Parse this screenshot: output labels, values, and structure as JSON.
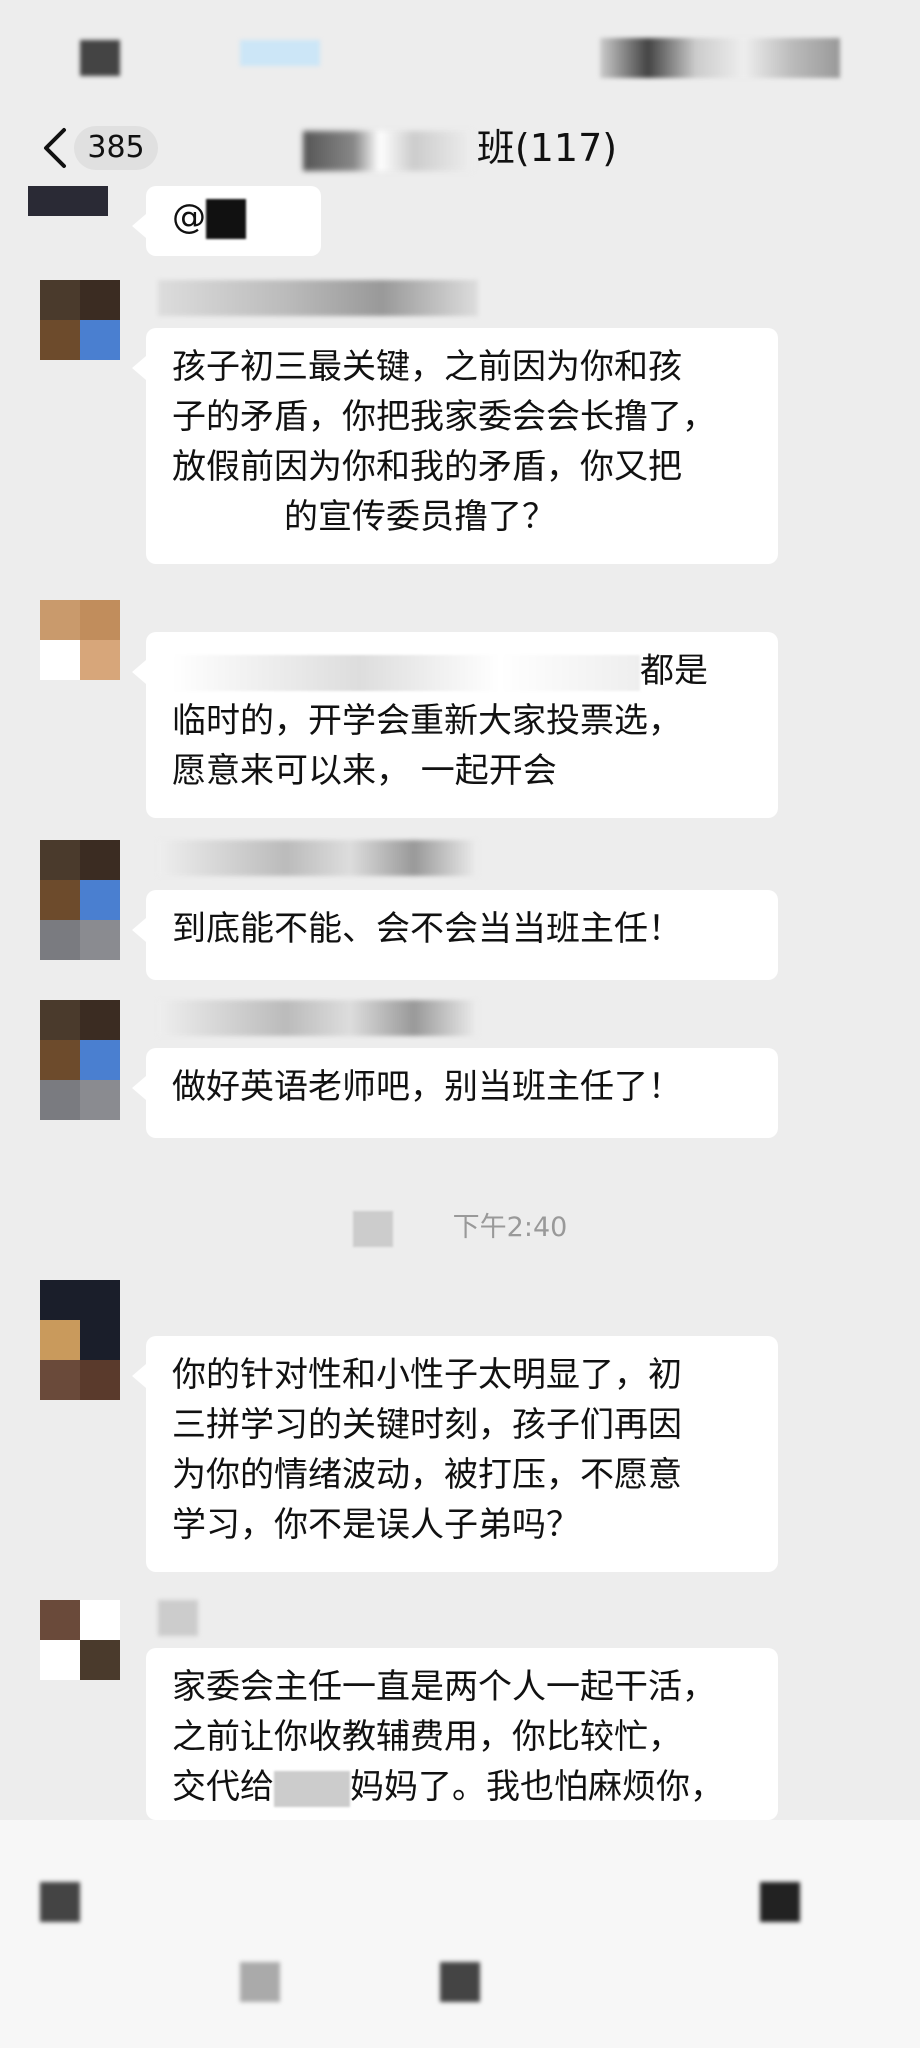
{
  "header": {
    "back_icon": "chevron-left-icon",
    "unread_count": "385",
    "title_suffix": "班(117)"
  },
  "messages": [
    {
      "text": "@"
    },
    {
      "lines": [
        "孩子初三最关键，之前因为你和孩",
        "子的矛盾，你把我家委会会长撸了，",
        "放假前因为你和我的矛盾，你又把",
        "的宣传委员撸了？"
      ]
    },
    {
      "lines": [
        "都是",
        "临时的，开学会重新大家投票选，",
        "愿意来可以来，  一起开会"
      ]
    },
    {
      "text": "到底能不能、会不会当当班主任！"
    },
    {
      "text": "做好英语老师吧，别当班主任了！"
    },
    {
      "lines": [
        "你的针对性和小性子太明显了，初",
        "三拼学习的关键时刻，孩子们再因",
        "为你的情绪波动，被打压，不愿意",
        "学习，你不是误人子弟吗？"
      ]
    },
    {
      "lines": [
        "家委会主任一直是两个人一起干活，",
        "之前让你收教辅费用，你比较忙，",
        "交代给",
        "妈妈了。我也怕麻烦你，"
      ]
    }
  ],
  "timestamp": "下午2:40",
  "colors": {
    "background": "#ededed",
    "bubble": "#ffffff",
    "accent": "#4a7fd0"
  }
}
